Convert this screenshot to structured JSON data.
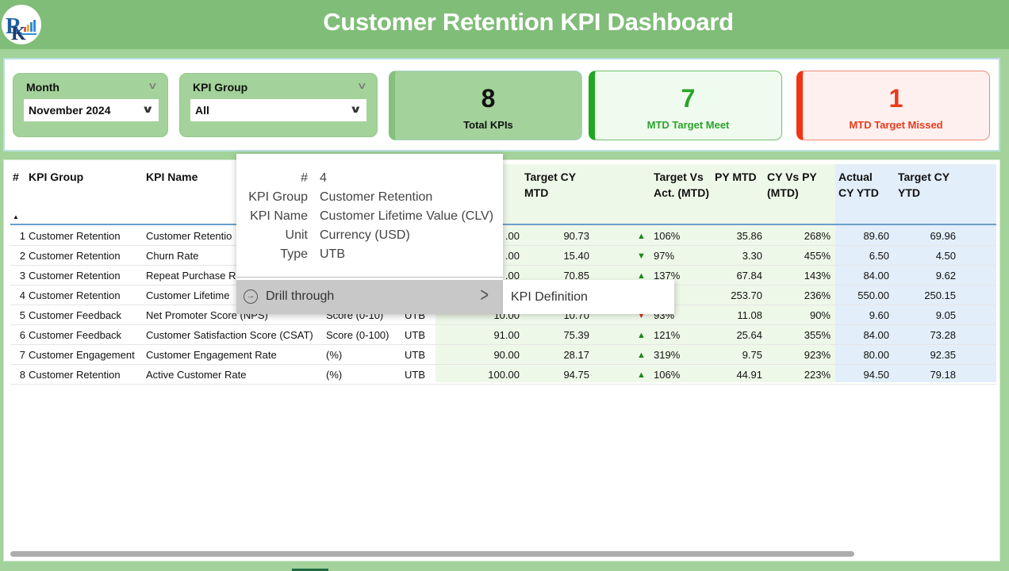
{
  "header": {
    "title": "Customer Retention KPI Dashboard",
    "logo_icon": "company-logo"
  },
  "slicers": {
    "month": {
      "label": "Month",
      "value": "November 2024"
    },
    "kpi_group": {
      "label": "KPI Group",
      "value": "All"
    }
  },
  "cards": {
    "total": {
      "value": "8",
      "label": "Total KPIs"
    },
    "meet": {
      "value": "7",
      "label": "MTD Target Meet"
    },
    "missed": {
      "value": "1",
      "label": "MTD Target Missed"
    }
  },
  "colors": {
    "header_green": "#80bd78",
    "panel_green": "#a3d29a",
    "meet_green": "#22a722",
    "missed_red": "#f03414",
    "mtd_bg": "#eef8e8",
    "ytd_bg": "#e2eefa"
  },
  "table": {
    "columns": {
      "num": "#",
      "kpi_group": "KPI Group",
      "kpi_name": "KPI Name",
      "target_cy_mtd": "Target CY MTD",
      "target_vs_act_mtd": "Target Vs Act. (MTD)",
      "py_mtd": "PY MTD",
      "cy_vs_py_mtd": "CY Vs PY (MTD)",
      "actual_cy_ytd": "Actual CY YTD",
      "target_cy_ytd": "Target CY YTD"
    },
    "rows": [
      {
        "num": "1",
        "group": "Customer Retention",
        "name": "Customer Retentio",
        "unit": "",
        "type": "",
        "actual_mtd": ".00",
        "target_mtd": "90.73",
        "trend": "up",
        "tva": "106%",
        "py_mtd": "35.86",
        "cvp": "268%",
        "actual_ytd": "89.60",
        "target_ytd": "69.96"
      },
      {
        "num": "2",
        "group": "Customer Retention",
        "name": "Churn Rate",
        "unit": "",
        "type": "",
        "actual_mtd": ".00",
        "target_mtd": "15.40",
        "trend": "down-green",
        "tva": "97%",
        "py_mtd": "3.30",
        "cvp": "455%",
        "actual_ytd": "6.50",
        "target_ytd": "4.50"
      },
      {
        "num": "3",
        "group": "Customer Retention",
        "name": "Repeat Purchase Ra",
        "unit": "",
        "type": "",
        "actual_mtd": ".00",
        "target_mtd": "70.85",
        "trend": "up",
        "tva": "137%",
        "py_mtd": "67.84",
        "cvp": "143%",
        "actual_ytd": "84.00",
        "target_ytd": "9.62"
      },
      {
        "num": "4",
        "group": "Customer Retention",
        "name": "Customer Lifetime",
        "unit": "",
        "type": "",
        "actual_mtd": "",
        "target_mtd": "",
        "trend": "",
        "tva": "%",
        "py_mtd": "253.70",
        "cvp": "236%",
        "actual_ytd": "550.00",
        "target_ytd": "250.15"
      },
      {
        "num": "5",
        "group": "Customer Feedback",
        "name": "Net Promoter Score (NPS)",
        "unit": "Score (0-10)",
        "type": "UTB",
        "actual_mtd": "10.00",
        "target_mtd": "10.70",
        "trend": "down-red",
        "tva": "93%",
        "py_mtd": "11.08",
        "cvp": "90%",
        "actual_ytd": "9.60",
        "target_ytd": "9.05"
      },
      {
        "num": "6",
        "group": "Customer Feedback",
        "name": "Customer Satisfaction Score (CSAT)",
        "unit": "Score (0-100)",
        "type": "UTB",
        "actual_mtd": "91.00",
        "target_mtd": "75.39",
        "trend": "up",
        "tva": "121%",
        "py_mtd": "25.64",
        "cvp": "355%",
        "actual_ytd": "84.00",
        "target_ytd": "73.28"
      },
      {
        "num": "7",
        "group": "Customer Engagement",
        "name": "Customer Engagement Rate",
        "unit": "(%)",
        "type": "UTB",
        "actual_mtd": "90.00",
        "target_mtd": "28.17",
        "trend": "up",
        "tva": "319%",
        "py_mtd": "9.75",
        "cvp": "923%",
        "actual_ytd": "80.00",
        "target_ytd": "92.35"
      },
      {
        "num": "8",
        "group": "Customer Retention",
        "name": "Active Customer Rate",
        "unit": "(%)",
        "type": "UTB",
        "actual_mtd": "100.00",
        "target_mtd": "94.75",
        "trend": "up",
        "tva": "106%",
        "py_mtd": "44.91",
        "cvp": "223%",
        "actual_ytd": "94.50",
        "target_ytd": "79.18"
      }
    ]
  },
  "tooltip": {
    "fields": [
      {
        "key": "#",
        "value": "4"
      },
      {
        "key": "KPI Group",
        "value": "Customer Retention"
      },
      {
        "key": "KPI Name",
        "value": "Customer Lifetime Value (CLV)"
      },
      {
        "key": "Unit",
        "value": "Currency (USD)"
      },
      {
        "key": "Type",
        "value": "UTB"
      }
    ],
    "drill_label": "Drill through",
    "submenu_item": "KPI Definition"
  },
  "glyphs": {
    "chevron_down": "∨",
    "sort_asc": "▲",
    "arrow_up": "▲",
    "arrow_down": "▼",
    "chevron_right": ">",
    "drill_icon": "→"
  }
}
